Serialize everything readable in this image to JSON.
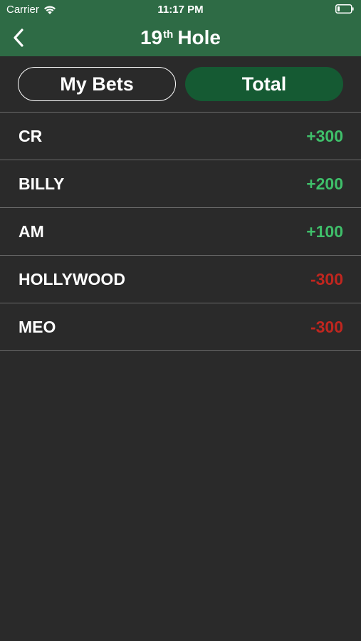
{
  "status": {
    "carrier": "Carrier",
    "time": "11:17 PM"
  },
  "nav": {
    "title_main": "19",
    "title_sup": "th",
    "title_rest": "Hole"
  },
  "tabs": {
    "my_bets": "My Bets",
    "total": "Total"
  },
  "colors": {
    "header": "#2e6b45",
    "background": "#2a2a2a",
    "active_tab": "#155a33",
    "positive": "#3fbf6a",
    "negative": "#c0261f"
  },
  "players": [
    {
      "name": "CR",
      "amount": "+300",
      "sign": "positive"
    },
    {
      "name": "BILLY",
      "amount": "+200",
      "sign": "positive"
    },
    {
      "name": "AM",
      "amount": "+100",
      "sign": "positive"
    },
    {
      "name": "HOLLYWOOD",
      "amount": "-300",
      "sign": "negative"
    },
    {
      "name": "MEO",
      "amount": "-300",
      "sign": "negative"
    }
  ]
}
